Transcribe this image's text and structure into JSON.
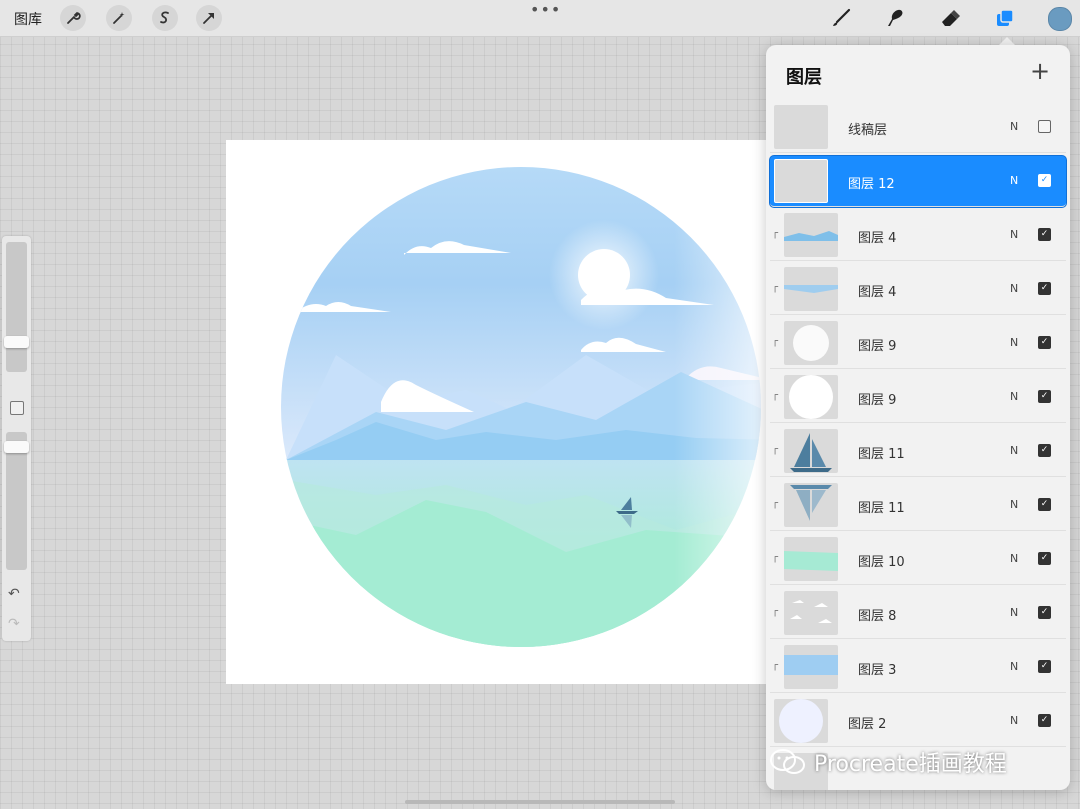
{
  "topbar": {
    "gallery_label": "图库",
    "tools": [
      "wrench-icon",
      "magic-wand-icon",
      "selection-icon",
      "transform-arrow-icon"
    ],
    "more_dots": "•••",
    "right_tools": [
      "brush-icon",
      "smudge-icon",
      "eraser-icon",
      "layers-icon"
    ],
    "current_color": "#6a9bc0"
  },
  "sidebar": {
    "undo_symbol": "↶",
    "redo_symbol": "↷"
  },
  "layers_panel": {
    "title": "图层",
    "add_symbol": "+",
    "layers": [
      {
        "name": "线稿层",
        "mode": "N",
        "visible": false,
        "clipped": false,
        "selected": false,
        "check": ""
      },
      {
        "name": "图层 12",
        "mode": "N",
        "visible": true,
        "clipped": false,
        "selected": true,
        "check": "✓"
      },
      {
        "name": "图层 4",
        "mode": "N",
        "visible": true,
        "clipped": true,
        "selected": false,
        "check": "✓"
      },
      {
        "name": "图层 4",
        "mode": "N",
        "visible": true,
        "clipped": true,
        "selected": false,
        "check": "✓"
      },
      {
        "name": "图层 9",
        "mode": "N",
        "visible": true,
        "clipped": true,
        "selected": false,
        "check": "✓"
      },
      {
        "name": "图层 9",
        "mode": "N",
        "visible": true,
        "clipped": true,
        "selected": false,
        "check": "✓"
      },
      {
        "name": "图层 11",
        "mode": "N",
        "visible": true,
        "clipped": true,
        "selected": false,
        "check": "✓"
      },
      {
        "name": "图层 11",
        "mode": "N",
        "visible": true,
        "clipped": true,
        "selected": false,
        "check": "✓"
      },
      {
        "name": "图层 10",
        "mode": "N",
        "visible": true,
        "clipped": true,
        "selected": false,
        "check": "✓"
      },
      {
        "name": "图层 8",
        "mode": "N",
        "visible": true,
        "clipped": true,
        "selected": false,
        "check": "✓"
      },
      {
        "name": "图层 3",
        "mode": "N",
        "visible": true,
        "clipped": true,
        "selected": false,
        "check": "✓"
      },
      {
        "name": "图层 2",
        "mode": "N",
        "visible": true,
        "clipped": false,
        "selected": false,
        "check": "✓"
      }
    ]
  },
  "watermark": {
    "text": "Procreate插画教程",
    "icon": "wechat-icon"
  },
  "colors": {
    "selection_blue": "#1a8cff",
    "sky_top": "#a9d4f5",
    "water_green": "#9fe8cf"
  }
}
